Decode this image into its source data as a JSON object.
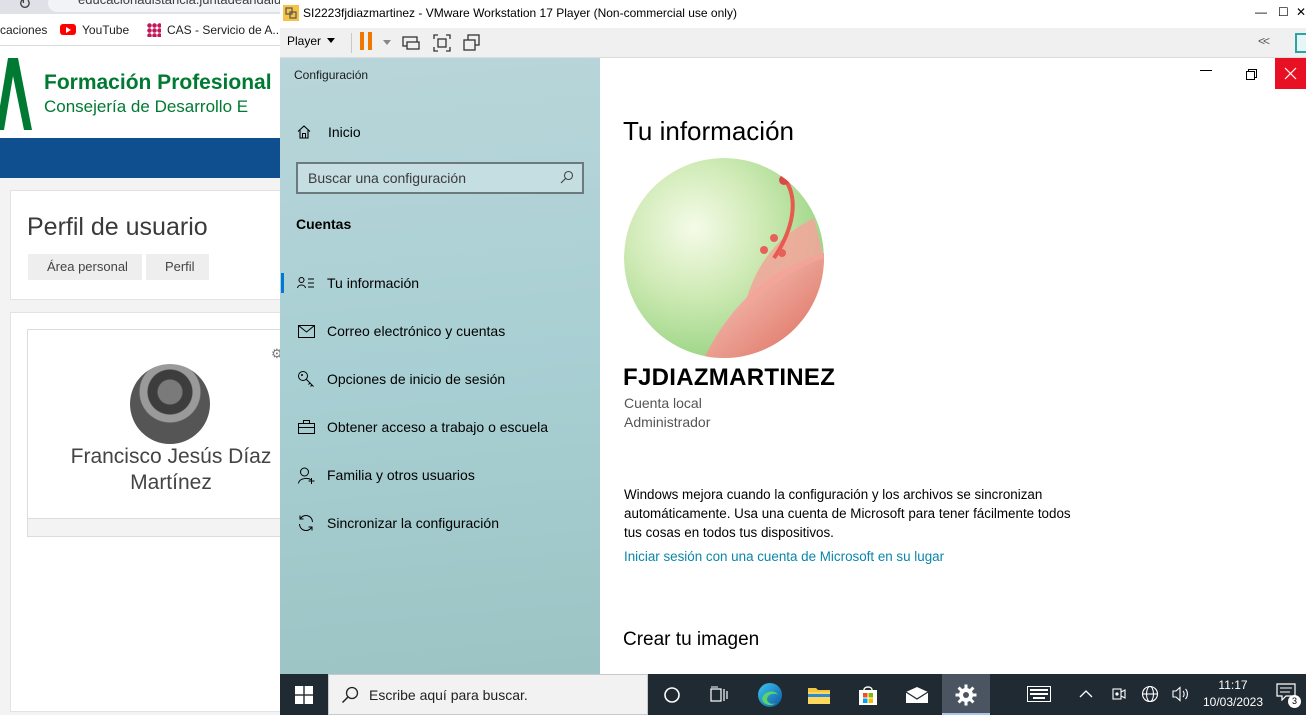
{
  "browser": {
    "url": "educacionadistancia.juntadeandalucia.es",
    "bookmarks": [
      "caciones",
      "YouTube",
      "CAS - Servicio de A..."
    ],
    "site_title": "Formación Profesional",
    "site_subtitle": "Consejería de Desarrollo E",
    "profile_heading": "Perfil de usuario",
    "breadcrumb": [
      "Área personal",
      "Perfil"
    ],
    "user_full_name": "Francisco Jesús Díaz Martínez"
  },
  "vmware": {
    "window_title": "SI2223fjdiazmartinez - VMware Workstation 17 Player (Non-commercial use only)",
    "player_menu": "Player",
    "collapse_glyph": "<<"
  },
  "settings": {
    "app_title": "Configuración",
    "home_label": "Inicio",
    "search_placeholder": "Buscar una configuración",
    "section": "Cuentas",
    "nav": [
      {
        "label": "Tu información",
        "icon": "person-card-icon",
        "active": true
      },
      {
        "label": "Correo electrónico y cuentas",
        "icon": "mail-icon",
        "active": false
      },
      {
        "label": "Opciones de inicio de sesión",
        "icon": "key-icon",
        "active": false
      },
      {
        "label": "Obtener acceso a trabajo o escuela",
        "icon": "briefcase-icon",
        "active": false
      },
      {
        "label": "Familia y otros usuarios",
        "icon": "person-add-icon",
        "active": false
      },
      {
        "label": "Sincronizar la configuración",
        "icon": "sync-icon",
        "active": false
      }
    ],
    "main": {
      "heading": "Tu información",
      "username": "FJDIAZMARTINEZ",
      "account_type": "Cuenta local",
      "account_role": "Administrador",
      "sync_text": "Windows mejora cuando la configuración y los archivos se sincronizan automáticamente. Usa una cuenta de Microsoft para tener fácilmente todos tus cosas en todos tus dispositivos.",
      "ms_link": "Iniciar sesión con una cuenta de Microsoft en su lugar",
      "create_heading": "Crear tu imagen"
    }
  },
  "taskbar": {
    "search_placeholder": "Escribe aquí para buscar.",
    "time": "11:17",
    "date": "10/03/2023",
    "notification_count": "3"
  },
  "colors": {
    "accent": "#0078d4",
    "link": "#0a86a8",
    "close_red": "#e81123",
    "taskbar": "#202a33",
    "fp_green": "#007a33"
  }
}
